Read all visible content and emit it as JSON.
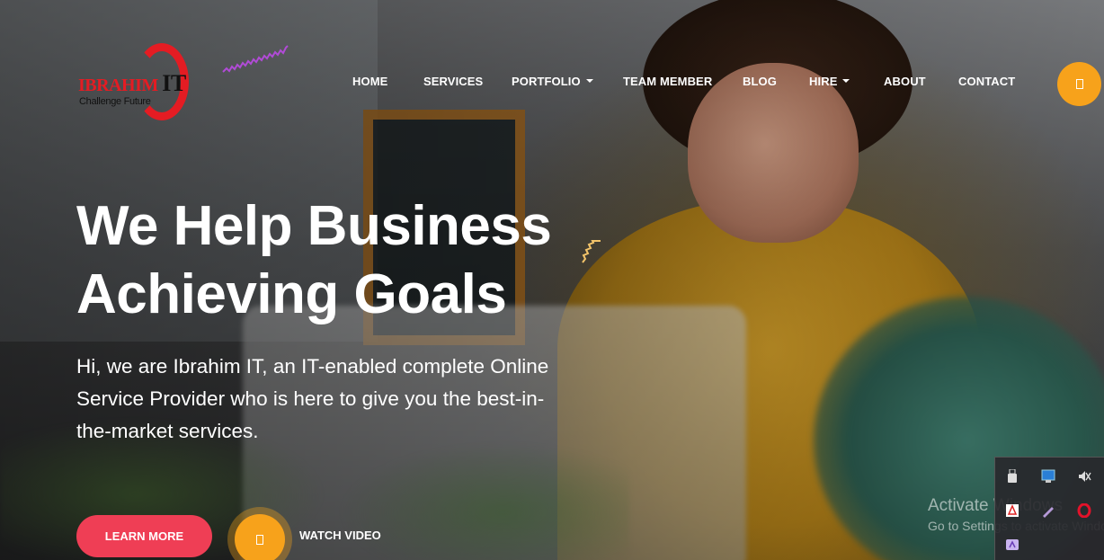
{
  "brand": {
    "name_main": "IBRAHIM",
    "name_it": "IT",
    "tagline": "Challenge Future"
  },
  "nav": {
    "items": [
      {
        "label": "HOME",
        "dropdown": false
      },
      {
        "label": "SERVICES",
        "dropdown": false
      },
      {
        "label": "PORTFOLIO",
        "dropdown": true
      },
      {
        "label": "TEAM MEMBER",
        "dropdown": false
      },
      {
        "label": "BLOG",
        "dropdown": false
      },
      {
        "label": "HIRE",
        "dropdown": true
      },
      {
        "label": "ABOUT",
        "dropdown": false
      },
      {
        "label": "CONTACT",
        "dropdown": false
      }
    ],
    "search_icon": "search-icon"
  },
  "hero": {
    "title_line1": "We Help Business",
    "title_line2": "Achieving Goals",
    "subtitle": "Hi, we are Ibrahim IT, an IT-enabled complete Online Service Provider who is here to give you the best-in-the-market services.",
    "cta_primary": "LEARN MORE",
    "cta_video": "WATCH VIDEO",
    "video_icon": "play-icon"
  },
  "os_overlay": {
    "activate_title": "Activate Windows",
    "activate_subtitle": "Go to Settings to activate Windows."
  },
  "colors": {
    "accent_orange": "#f7a21b",
    "button_red": "#ef3e55",
    "logo_red": "#e41c23",
    "squiggle_purple": "#b04bd6",
    "squiggle_yellow": "#f3c46a"
  }
}
